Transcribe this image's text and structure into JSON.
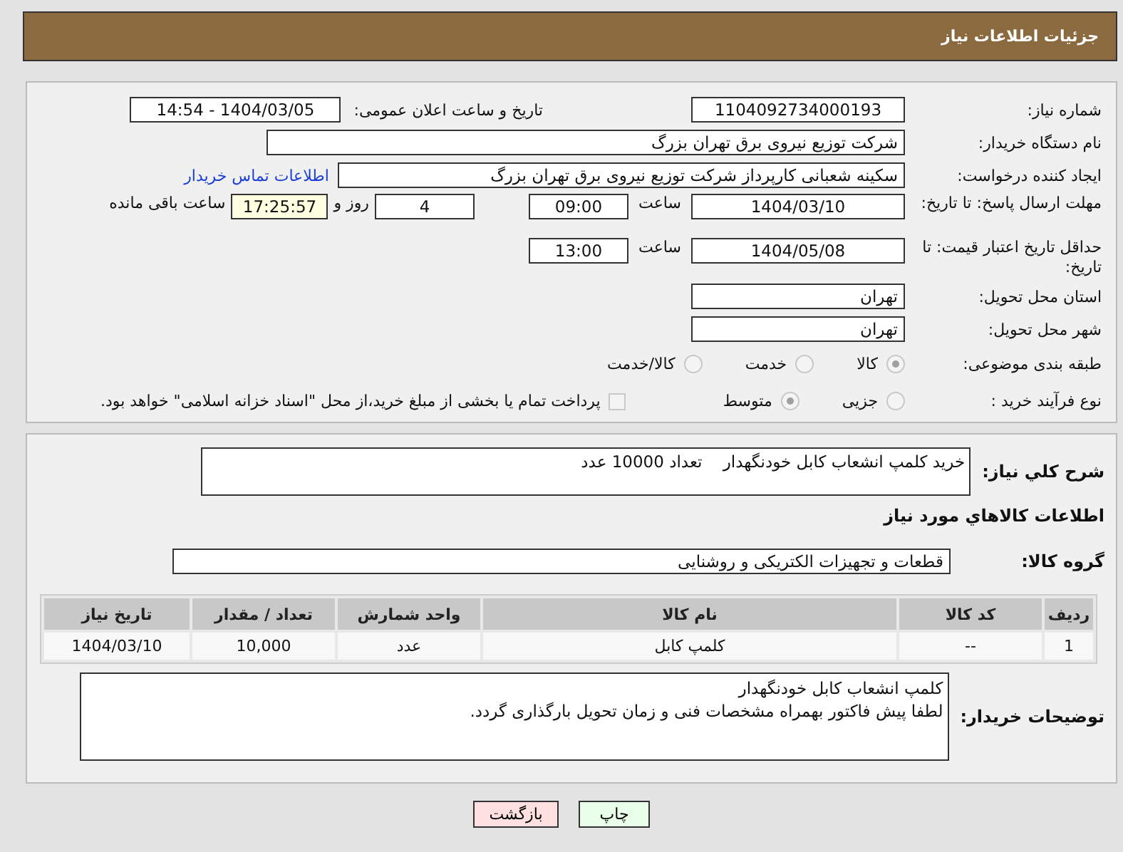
{
  "header": {
    "title": "جزئیات اطلاعات نیاز"
  },
  "need_number": {
    "label": "شماره نیاز:",
    "value": "1104092734000193"
  },
  "announce": {
    "label": "تاریخ و ساعت اعلان عمومی:",
    "value": "1404/03/05 - 14:54"
  },
  "buyer_org": {
    "label": "نام دستگاه خریدار:",
    "value": "شرکت توزیع نیروی برق تهران بزرگ"
  },
  "requester": {
    "label": "ایجاد کننده درخواست:",
    "value": "سکینه شعبانی کارپرداز شرکت توزیع نیروی برق تهران بزرگ",
    "link": "اطلاعات تماس خریدار"
  },
  "deadline": {
    "label": "مهلت ارسال پاسخ: تا تاریخ:",
    "date": "1404/03/10",
    "time_label": "ساعت",
    "time": "09:00",
    "days": "4",
    "days_label": "روز و",
    "remaining": "17:25:57",
    "remaining_label": "ساعت باقی مانده"
  },
  "price_validity": {
    "label": "حداقل تاریخ اعتبار قیمت: تا تاریخ:",
    "date": "1404/05/08",
    "time_label": "ساعت",
    "time": "13:00"
  },
  "province": {
    "label": "استان محل تحویل:",
    "value": "تهران"
  },
  "city": {
    "label": "شهر محل تحویل:",
    "value": "تهران"
  },
  "category": {
    "label": "طبقه بندی موضوعی:",
    "options": [
      {
        "label": "کالا",
        "selected": true
      },
      {
        "label": "خدمت",
        "selected": false
      },
      {
        "label": "کالا/خدمت",
        "selected": false
      }
    ]
  },
  "purchase_type": {
    "label": "نوع فرآیند خرید :",
    "options": [
      {
        "label": "جزیی",
        "selected": false
      },
      {
        "label": "متوسط",
        "selected": true
      }
    ],
    "payment": {
      "checked": false,
      "text": "پرداخت تمام یا بخشی از مبلغ خرید،از محل \"اسناد خزانه اسلامی\" خواهد بود."
    }
  },
  "description": {
    "label": "شرح کلي نياز:",
    "value": "خرید کلمپ انشعاب کابل خودنگهدار    تعداد 10000 عدد"
  },
  "goods_heading": "اطلاعات کالاهاي مورد نياز",
  "goods_group": {
    "label": "گروه کالا:",
    "value": "قطعات و تجهیزات الکتریکی و روشنایی"
  },
  "table": {
    "columns": [
      "ردیف",
      "کد کالا",
      "نام کالا",
      "واحد شمارش",
      "تعداد / مقدار",
      "تاریخ نیاز"
    ],
    "rows": [
      [
        "1",
        "--",
        "کلمپ کابل",
        "عدد",
        "10,000",
        "1404/03/10"
      ]
    ]
  },
  "buyer_notes": {
    "label": "توضیحات خریدار:",
    "lines": [
      "کلمپ انشعاب کابل خودنگهدار",
      "لطفا پیش فاکتور بهمراه مشخصات فنی و زمان تحویل بارگذاری گردد."
    ]
  },
  "buttons": [
    {
      "label": "چاپ",
      "kind": "print"
    },
    {
      "label": "بازگشت",
      "kind": "back"
    }
  ]
}
